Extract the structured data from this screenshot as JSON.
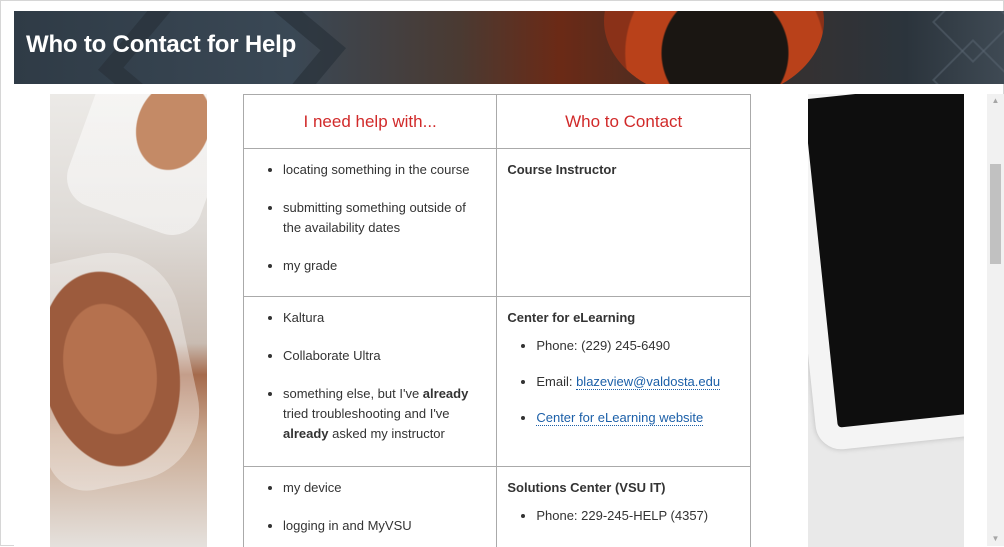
{
  "banner": {
    "title": "Who to Contact for Help"
  },
  "table": {
    "headers": [
      "I need help with...",
      "Who to Contact"
    ],
    "rows": [
      {
        "help_items": [
          "locating something in the course",
          "submitting something outside of the availability dates",
          "my grade"
        ],
        "contact_name": "Course Instructor"
      },
      {
        "help_items": [
          "Kaltura",
          "Collaborate Ultra"
        ],
        "help_item_rich": {
          "part1": "something else, but I've ",
          "bold1": "already",
          "part2": " tried troubleshooting and I've ",
          "bold2": "already",
          "part3": " asked my instructor"
        },
        "contact_name": "Center for eLearning",
        "phone_label": "Phone: (229) 245-6490",
        "email_label": "Email: ",
        "email_link": "blazeview@valdosta.edu",
        "website_link": "Center for eLearning website"
      },
      {
        "help_items": [
          "my device",
          "logging in and MyVSU"
        ],
        "contact_name": "Solutions Center (VSU IT)",
        "phone_label": "Phone: 229-245-HELP (4357)"
      }
    ]
  },
  "icons": {
    "scroll_up": "scroll-up-arrow",
    "scroll_down": "scroll-down-arrow"
  },
  "colors": {
    "header_red": "#d12a2a",
    "link_blue": "#1b5fa8"
  }
}
